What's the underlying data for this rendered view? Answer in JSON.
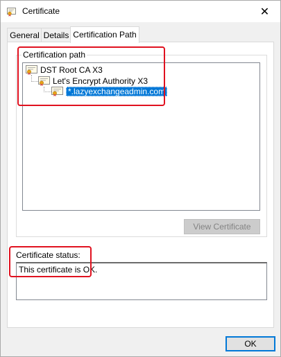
{
  "window": {
    "title": "Certificate",
    "close_glyph": "✕",
    "title_icon": "certificate-icon"
  },
  "tabs": [
    {
      "label": "General",
      "active": false
    },
    {
      "label": "Details",
      "active": false
    },
    {
      "label": "Certification Path",
      "active": true
    }
  ],
  "certification_path": {
    "group_label": "Certification path",
    "nodes": [
      {
        "label": "DST Root CA X3",
        "icon": "certificate-icon",
        "level": 0,
        "selected": false
      },
      {
        "label": "Let's Encrypt Authority X3",
        "icon": "certificate-icon",
        "level": 1,
        "selected": false
      },
      {
        "label": "*.lazyexchangeadmin.com",
        "icon": "certificate-icon",
        "level": 2,
        "selected": true
      }
    ],
    "view_button_label": "View Certificate",
    "view_button_enabled": false
  },
  "status": {
    "label": "Certificate status:",
    "text": "This certificate is OK."
  },
  "footer": {
    "ok_label": "OK"
  },
  "colors": {
    "selection": "#0078d7",
    "highlight_annotation": "#e0111f",
    "dialog_background": "#f0f0f0",
    "disabled_button": "#cccccc"
  }
}
